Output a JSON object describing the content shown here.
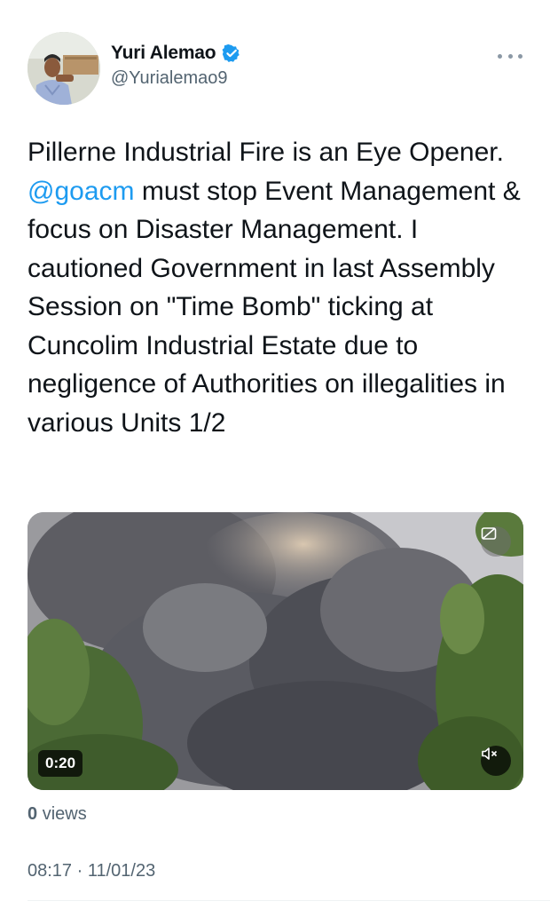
{
  "author": {
    "display_name": "Yuri Alemao",
    "handle": "@Yurialemao9",
    "verified": true,
    "avatar_icon": "profile-photo"
  },
  "tweet": {
    "text_before": "Pillerne Industrial Fire is an Eye Opener. ",
    "mention": "@goacm",
    "text_after": " must stop Event Management & focus on Disaster Management. I cautioned Government in last Assembly Session on \"Time Bomb\" ticking at Cuncolim Industrial Estate due to negligence of Authorities on illegalities in various Units 1/2"
  },
  "media": {
    "duration": "0:20",
    "mute_icon": "speaker-muted-icon",
    "caption_icon": "captions-icon"
  },
  "stats": {
    "views_count": "0",
    "views_label": "views"
  },
  "meta": {
    "timestamp": "08:17 · 11/01/23"
  },
  "colors": {
    "accent": "#1d9bf0",
    "secondary_text": "#536471",
    "primary_text": "#0f1419"
  }
}
